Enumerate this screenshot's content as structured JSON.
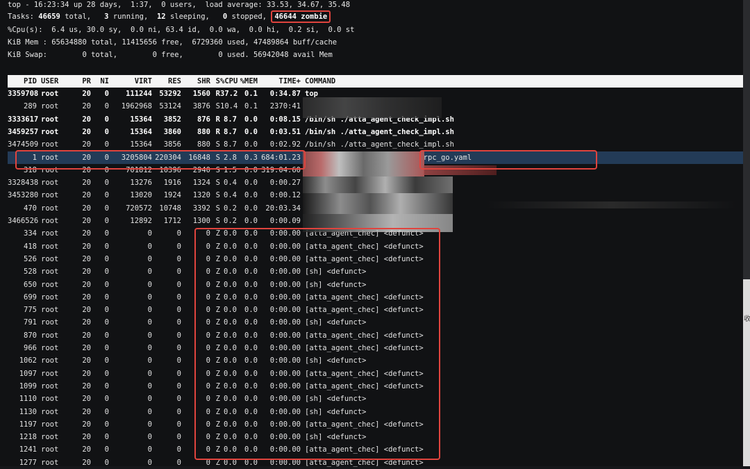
{
  "summary": {
    "top_line": "top - 16:23:34 up 28 days,  1:37,  0 users,  load average: 33.53, 34.67, 35.48",
    "tasks_prefix": "Tasks: ",
    "tasks_total": "46659",
    "tasks_mid": " total,   ",
    "tasks_running": "3",
    "tasks_mid2": " running,  ",
    "tasks_sleeping": "12",
    "tasks_mid3": " sleeping,   ",
    "tasks_stopped": "0",
    "tasks_mid4": " stopped, ",
    "tasks_zombie": "46644 zombie",
    "cpu_line": "%Cpu(s):  6.4 us, 30.0 sy,  0.0 ni, 63.4 id,  0.0 wa,  0.0 hi,  0.2 si,  0.0 st",
    "mem_line": "KiB Mem : 65634880 total, 11415656 free,  6729360 used, 47489864 buff/cache",
    "swap_line": "KiB Swap:        0 total,        0 free,        0 used. 56942048 avail Mem"
  },
  "columns": {
    "pid": "PID",
    "user": "USER",
    "pr": "PR",
    "ni": "NI",
    "virt": "VIRT",
    "res": "RES",
    "shr": "SHR",
    "s": "S",
    "cpu": "%CPU",
    "mem": "%MEM",
    "time": "TIME+",
    "command": "COMMAND"
  },
  "processes": [
    {
      "pid": "3359708",
      "user": "root",
      "pr": "20",
      "ni": "0",
      "virt": "111244",
      "res": "53292",
      "shr": "1560",
      "s": "R",
      "cpu": "37.2",
      "mem": "0.1",
      "time": "0:34.87",
      "command": "top",
      "bold": true
    },
    {
      "pid": "289",
      "user": "root",
      "pr": "20",
      "ni": "0",
      "virt": "1962968",
      "res": "53124",
      "shr": "3876",
      "s": "S",
      "cpu": "10.4",
      "mem": "0.1",
      "time": "2370:41",
      "command": ""
    },
    {
      "pid": "3333617",
      "user": "root",
      "pr": "20",
      "ni": "0",
      "virt": "15364",
      "res": "3852",
      "shr": "876",
      "s": "R",
      "cpu": "8.7",
      "mem": "0.0",
      "time": "0:08.15",
      "command": "/bin/sh ./atta_agent_check_impl.sh",
      "bold": true
    },
    {
      "pid": "3459257",
      "user": "root",
      "pr": "20",
      "ni": "0",
      "virt": "15364",
      "res": "3860",
      "shr": "880",
      "s": "R",
      "cpu": "8.7",
      "mem": "0.0",
      "time": "0:03.51",
      "command": "/bin/sh ./atta_agent_check_impl.sh",
      "bold": true
    },
    {
      "pid": "3474509",
      "user": "root",
      "pr": "20",
      "ni": "0",
      "virt": "15364",
      "res": "3856",
      "shr": "880",
      "s": "S",
      "cpu": "8.7",
      "mem": "0.0",
      "time": "0:02.92",
      "command": "/bin/sh ./atta_agent_check_impl.sh"
    },
    {
      "pid": "1",
      "user": "root",
      "pr": "20",
      "ni": "0",
      "virt": "3205804",
      "res": "220304",
      "shr": "16848",
      "s": "S",
      "cpu": "2.8",
      "mem": "0.3",
      "time": "684:01.23",
      "command": "-conf=/usr/local/trpc/bin/trpc_go.yaml",
      "highlight": true
    },
    {
      "pid": "318",
      "user": "root",
      "pr": "20",
      "ni": "0",
      "virt": "701812",
      "res": "10396",
      "shr": "2940",
      "s": "S",
      "cpu": "1.5",
      "mem": "0.0",
      "time": "319:04.60",
      "command": ""
    },
    {
      "pid": "3328438",
      "user": "root",
      "pr": "20",
      "ni": "0",
      "virt": "13276",
      "res": "1916",
      "shr": "1324",
      "s": "S",
      "cpu": "0.4",
      "mem": "0.0",
      "time": "0:00.27",
      "command": ""
    },
    {
      "pid": "3453280",
      "user": "root",
      "pr": "20",
      "ni": "0",
      "virt": "13020",
      "res": "1924",
      "shr": "1320",
      "s": "S",
      "cpu": "0.4",
      "mem": "0.0",
      "time": "0:00.12",
      "command": ""
    },
    {
      "pid": "470",
      "user": "root",
      "pr": "20",
      "ni": "0",
      "virt": "720572",
      "res": "10748",
      "shr": "3392",
      "s": "S",
      "cpu": "0.2",
      "mem": "0.0",
      "time": "20:03.34",
      "command": ""
    },
    {
      "pid": "3466526",
      "user": "root",
      "pr": "20",
      "ni": "0",
      "virt": "12892",
      "res": "1712",
      "shr": "1300",
      "s": "S",
      "cpu": "0.2",
      "mem": "0.0",
      "time": "0:00.09",
      "command": ""
    },
    {
      "pid": "334",
      "user": "root",
      "pr": "20",
      "ni": "0",
      "virt": "0",
      "res": "0",
      "shr": "0",
      "s": "Z",
      "cpu": "0.0",
      "mem": "0.0",
      "time": "0:00.00",
      "command": "[atta_agent_chec] <defunct>"
    },
    {
      "pid": "418",
      "user": "root",
      "pr": "20",
      "ni": "0",
      "virt": "0",
      "res": "0",
      "shr": "0",
      "s": "Z",
      "cpu": "0.0",
      "mem": "0.0",
      "time": "0:00.00",
      "command": "[atta_agent_chec] <defunct>"
    },
    {
      "pid": "526",
      "user": "root",
      "pr": "20",
      "ni": "0",
      "virt": "0",
      "res": "0",
      "shr": "0",
      "s": "Z",
      "cpu": "0.0",
      "mem": "0.0",
      "time": "0:00.00",
      "command": "[atta_agent_chec] <defunct>"
    },
    {
      "pid": "528",
      "user": "root",
      "pr": "20",
      "ni": "0",
      "virt": "0",
      "res": "0",
      "shr": "0",
      "s": "Z",
      "cpu": "0.0",
      "mem": "0.0",
      "time": "0:00.00",
      "command": "[sh] <defunct>"
    },
    {
      "pid": "650",
      "user": "root",
      "pr": "20",
      "ni": "0",
      "virt": "0",
      "res": "0",
      "shr": "0",
      "s": "Z",
      "cpu": "0.0",
      "mem": "0.0",
      "time": "0:00.00",
      "command": "[sh] <defunct>"
    },
    {
      "pid": "699",
      "user": "root",
      "pr": "20",
      "ni": "0",
      "virt": "0",
      "res": "0",
      "shr": "0",
      "s": "Z",
      "cpu": "0.0",
      "mem": "0.0",
      "time": "0:00.00",
      "command": "[atta_agent_chec] <defunct>"
    },
    {
      "pid": "775",
      "user": "root",
      "pr": "20",
      "ni": "0",
      "virt": "0",
      "res": "0",
      "shr": "0",
      "s": "Z",
      "cpu": "0.0",
      "mem": "0.0",
      "time": "0:00.00",
      "command": "[atta_agent_chec] <defunct>"
    },
    {
      "pid": "791",
      "user": "root",
      "pr": "20",
      "ni": "0",
      "virt": "0",
      "res": "0",
      "shr": "0",
      "s": "Z",
      "cpu": "0.0",
      "mem": "0.0",
      "time": "0:00.00",
      "command": "[sh] <defunct>"
    },
    {
      "pid": "870",
      "user": "root",
      "pr": "20",
      "ni": "0",
      "virt": "0",
      "res": "0",
      "shr": "0",
      "s": "Z",
      "cpu": "0.0",
      "mem": "0.0",
      "time": "0:00.00",
      "command": "[atta_agent_chec] <defunct>"
    },
    {
      "pid": "966",
      "user": "root",
      "pr": "20",
      "ni": "0",
      "virt": "0",
      "res": "0",
      "shr": "0",
      "s": "Z",
      "cpu": "0.0",
      "mem": "0.0",
      "time": "0:00.00",
      "command": "[atta_agent_chec] <defunct>"
    },
    {
      "pid": "1062",
      "user": "root",
      "pr": "20",
      "ni": "0",
      "virt": "0",
      "res": "0",
      "shr": "0",
      "s": "Z",
      "cpu": "0.0",
      "mem": "0.0",
      "time": "0:00.00",
      "command": "[sh] <defunct>"
    },
    {
      "pid": "1097",
      "user": "root",
      "pr": "20",
      "ni": "0",
      "virt": "0",
      "res": "0",
      "shr": "0",
      "s": "Z",
      "cpu": "0.0",
      "mem": "0.0",
      "time": "0:00.00",
      "command": "[atta_agent_chec] <defunct>"
    },
    {
      "pid": "1099",
      "user": "root",
      "pr": "20",
      "ni": "0",
      "virt": "0",
      "res": "0",
      "shr": "0",
      "s": "Z",
      "cpu": "0.0",
      "mem": "0.0",
      "time": "0:00.00",
      "command": "[atta_agent_chec] <defunct>"
    },
    {
      "pid": "1110",
      "user": "root",
      "pr": "20",
      "ni": "0",
      "virt": "0",
      "res": "0",
      "shr": "0",
      "s": "Z",
      "cpu": "0.0",
      "mem": "0.0",
      "time": "0:00.00",
      "command": "[sh] <defunct>"
    },
    {
      "pid": "1130",
      "user": "root",
      "pr": "20",
      "ni": "0",
      "virt": "0",
      "res": "0",
      "shr": "0",
      "s": "Z",
      "cpu": "0.0",
      "mem": "0.0",
      "time": "0:00.00",
      "command": "[sh] <defunct>"
    },
    {
      "pid": "1197",
      "user": "root",
      "pr": "20",
      "ni": "0",
      "virt": "0",
      "res": "0",
      "shr": "0",
      "s": "Z",
      "cpu": "0.0",
      "mem": "0.0",
      "time": "0:00.00",
      "command": "[atta_agent_chec] <defunct>"
    },
    {
      "pid": "1218",
      "user": "root",
      "pr": "20",
      "ni": "0",
      "virt": "0",
      "res": "0",
      "shr": "0",
      "s": "Z",
      "cpu": "0.0",
      "mem": "0.0",
      "time": "0:00.00",
      "command": "[sh] <defunct>"
    },
    {
      "pid": "1241",
      "user": "root",
      "pr": "20",
      "ni": "0",
      "virt": "0",
      "res": "0",
      "shr": "0",
      "s": "Z",
      "cpu": "0.0",
      "mem": "0.0",
      "time": "0:00.00",
      "command": "[atta_agent_chec] <defunct>"
    },
    {
      "pid": "1277",
      "user": "root",
      "pr": "20",
      "ni": "0",
      "virt": "0",
      "res": "0",
      "shr": "0",
      "s": "Z",
      "cpu": "0.0",
      "mem": "0.0",
      "time": "0:00.00",
      "command": "[atta_agent_chec] <defunct>"
    }
  ],
  "side_panel": {
    "char": "收"
  },
  "colors": {
    "annotation_red": "#e0443e",
    "selected_row": "#233b57",
    "header_bg": "#f5f5f5",
    "terminal_bg": "#111214"
  }
}
